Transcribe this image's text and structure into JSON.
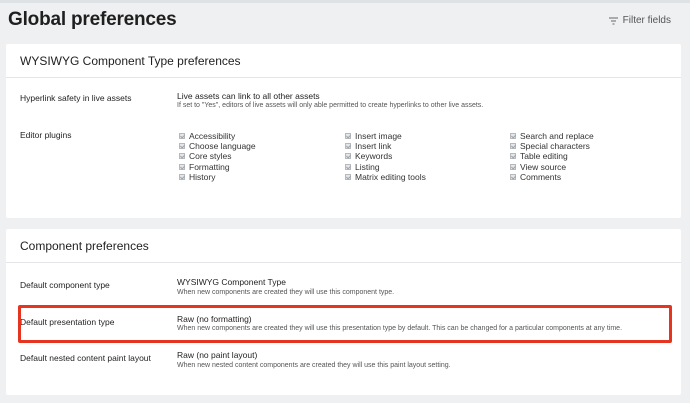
{
  "page": {
    "title": "Global preferences"
  },
  "filter": {
    "label": "Filter fields",
    "icon": "filter-icon"
  },
  "wysiwyg": {
    "title": "WYSIWYG Component Type preferences",
    "hyperlink": {
      "label": "Hyperlink safety in live assets",
      "value": "Live assets can link to all other assets",
      "hint": "If set to \"Yes\", editors of live assets will only able permitted to create hyperlinks to other live assets."
    },
    "plugins": {
      "label": "Editor plugins",
      "col1": [
        "Accessibility",
        "Choose language",
        "Core styles",
        "Formatting",
        "History"
      ],
      "col2": [
        "Insert image",
        "Insert link",
        "Keywords",
        "Listing",
        "Matrix editing tools"
      ],
      "col3": [
        "Search and replace",
        "Special characters",
        "Table editing",
        "View source",
        "Comments"
      ]
    }
  },
  "component": {
    "title": "Component preferences",
    "type": {
      "label": "Default component type",
      "value": "WYSIWYG Component Type",
      "hint": "When new components are created they will use this component type."
    },
    "presentation": {
      "label": "Default presentation type",
      "value": "Raw (no formatting)",
      "hint": "When new components are created they will use this presentation type by default. This can be changed for a particular components at any time."
    },
    "nested": {
      "label": "Default nested content paint layout",
      "value": "Raw (no paint layout)",
      "hint": "When new nested content components are created they will use this paint layout setting."
    }
  },
  "colors": {
    "highlight": "#e5341f",
    "background": "#eef0f2",
    "card": "#ffffff"
  }
}
